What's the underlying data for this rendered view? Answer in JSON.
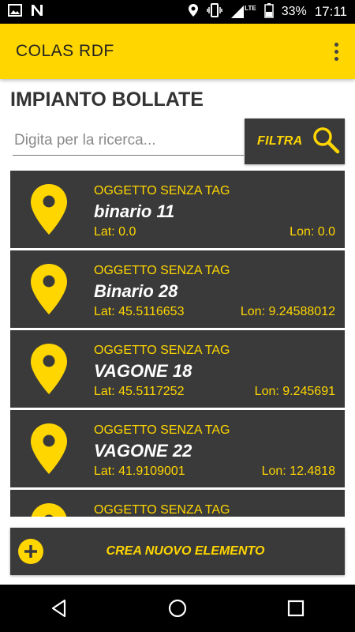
{
  "status_bar": {
    "battery_percent": "33%",
    "time": "17:11",
    "network": "LTE",
    "icons": [
      "image-icon",
      "n-icon",
      "location-icon",
      "vibrate-icon",
      "signal-icon",
      "battery-icon"
    ]
  },
  "app_bar": {
    "title": "COLAS RDF",
    "overflow_icon": "more-vert-icon"
  },
  "section": {
    "title": "IMPIANTO BOLLATE"
  },
  "search": {
    "placeholder": "Digita per la ricerca...",
    "value": ""
  },
  "filter": {
    "label": "FILTRA",
    "icon": "search-icon"
  },
  "items": [
    {
      "tag": "OGGETTO SENZA TAG",
      "name": "binario 11",
      "lat": "Lat: 0.0",
      "lon": "Lon: 0.0"
    },
    {
      "tag": "OGGETTO SENZA TAG",
      "name": "Binario 28",
      "lat": "Lat: 45.5116653",
      "lon": "Lon: 9.24588012"
    },
    {
      "tag": "OGGETTO SENZA TAG",
      "name": "VAGONE 18",
      "lat": "Lat: 45.5117252",
      "lon": "Lon: 9.245691"
    },
    {
      "tag": "OGGETTO SENZA TAG",
      "name": "VAGONE 22",
      "lat": "Lat: 41.9109001",
      "lon": "Lon: 12.4818"
    },
    {
      "tag": "OGGETTO SENZA TAG",
      "name": "",
      "lat": "",
      "lon": ""
    }
  ],
  "create_button": {
    "label": "CREA NUOVO ELEMENTO",
    "icon": "add-circle-icon"
  },
  "colors": {
    "accent": "#ffd600",
    "card": "#3a3a3a",
    "text_dark": "#333333"
  },
  "nav_bar": {
    "icons": [
      "back-icon",
      "home-icon",
      "recents-icon"
    ]
  }
}
